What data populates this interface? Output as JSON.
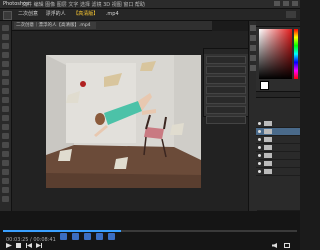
{
  "app": {
    "name": "Photoshop",
    "menu": "文件  编辑  图像  图层  文字  选择  滤镜  3D  视图  窗口  帮助"
  },
  "document": {
    "tab_title": "二次创意｜漂浮的人【高清版】.mp4"
  },
  "title_bar": {
    "segments": [
      "二次创意",
      "漂浮的人",
      "【高清版】",
      ".mp4"
    ],
    "highlight_index": 2
  },
  "artwork": {
    "description_icon": "image-icon",
    "colors": {
      "wall": "#d9d7d2",
      "floor": "#6b4b39",
      "dress": "#4cc2a8",
      "chair": "#7a4a3c",
      "book": "#d8c59d"
    }
  },
  "color_panel": {
    "foreground": "#ffffff"
  },
  "player": {
    "time": "00:03:25 / 00:08:41",
    "progress": 0.4
  },
  "colors": {
    "accent": "#3aa0ff",
    "highlight": "#ffcc33",
    "selection": "#4a6a8a"
  }
}
